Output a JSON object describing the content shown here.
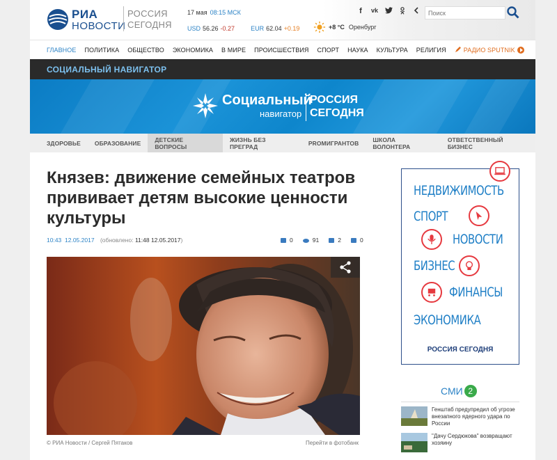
{
  "header": {
    "logo_top": "РИА",
    "logo_bottom": "НОВОСТИ",
    "logo_right_top": "РОССИЯ",
    "logo_right_bottom": "СЕГОДНЯ",
    "date": "17 мая",
    "time": "08:15 МСК",
    "usd_label": "USD",
    "usd_value": "56.26",
    "usd_change": "-0.27",
    "eur_label": "EUR",
    "eur_value": "62.04",
    "eur_change": "+0.19",
    "temperature": "+8 °C",
    "city": "Оренбург",
    "social": [
      "f",
      "vk",
      "tw",
      "ok",
      "‹"
    ],
    "search_placeholder": "Поиск"
  },
  "nav": {
    "items": [
      "ГЛАВНОЕ",
      "ПОЛИТИКА",
      "ОБЩЕСТВО",
      "ЭКОНОМИКА",
      "В МИРЕ",
      "ПРОИСШЕСТВИЯ",
      "СПОРТ",
      "НАУКА",
      "КУЛЬТУРА",
      "РЕЛИГИЯ"
    ],
    "radio": "РАДИО SPUTNIK"
  },
  "section_title": "СОЦИАЛЬНЫЙ НАВИГАТОР",
  "banner": {
    "title": "Социальный",
    "subtitle": "навигатор",
    "right_top": "РОССИЯ",
    "right_bottom": "СЕГОДНЯ"
  },
  "subnav": {
    "items": [
      "ЗДОРОВЬЕ",
      "ОБРАЗОВАНИЕ",
      "ДЕТСКИЕ ВОПРОСЫ",
      "ЖИЗНЬ БЕЗ ПРЕГРАД",
      "PROМИГРАНТОВ",
      "ШКОЛА ВОЛОНТЕРА",
      "ОТВЕТСТВЕННЫЙ БИЗНЕС"
    ],
    "active_index": 2
  },
  "article": {
    "title": "Князев: движение семейных театров прививает детям высокие ценности культуры",
    "time": "10:43",
    "date": "12.05.2017",
    "updated_label": "(обновлено:",
    "updated_value": "11:48 12.05.2017",
    "updated_close": ")",
    "comments": "0",
    "views": "91",
    "likes": "2",
    "dislikes": "0",
    "photo_credit": "© РИА Новости / Сергей Пятаков",
    "photobank_link": "Перейти в фотобанк"
  },
  "ad": {
    "words": [
      "НЕДВИЖИМОСТЬ",
      "СПОРТ",
      "НОВОСТИ",
      "БИЗНЕС",
      "ФИНАНСЫ",
      "ЭКОНОМИКА"
    ],
    "footer": "РОССИЯ СЕГОДНЯ"
  },
  "smi": {
    "label": "СМИ",
    "badge": "2",
    "news": [
      "Генштаб предупредил об угрозе внезапного ядерного удара по России",
      "\"Дачу Сердюкова\" возвращают хозяину"
    ]
  },
  "colors": {
    "accent": "#2c83c6",
    "dark_bar": "#2a2a2a",
    "banner_blue": "#1b93d8",
    "radio_orange": "#e06d1f",
    "negative": "#c0392b",
    "positive": "#e67e22",
    "badge_green": "#3aaa4a",
    "ad_red": "#e6393f"
  }
}
